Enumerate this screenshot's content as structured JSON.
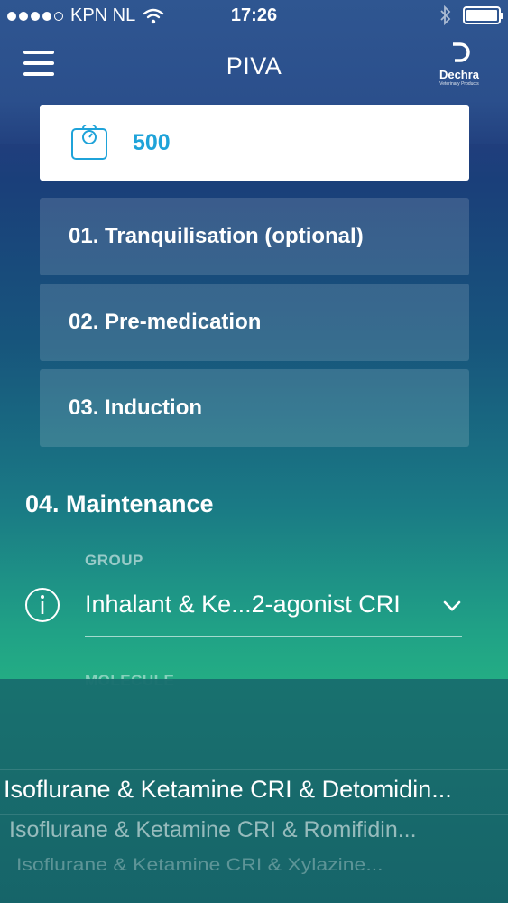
{
  "status_bar": {
    "carrier": "KPN NL",
    "time": "17:26",
    "signal_bars": 4,
    "signal_total": 5
  },
  "nav": {
    "title": "PIVA",
    "menu_icon": "hamburger-menu-icon",
    "logo_name": "Dechra",
    "logo_sub": "Veterinary Products"
  },
  "weight": {
    "icon": "scale-icon",
    "value": "500",
    "color": "#1fa3d9"
  },
  "steps": [
    {
      "label": "01. Tranquilisation (optional)"
    },
    {
      "label": "02. Pre-medication"
    },
    {
      "label": "03. Induction"
    }
  ],
  "maintenance": {
    "title": "04. Maintenance",
    "group_label": "GROUP",
    "group_value": "Inhalant & Ke...2-agonist CRI",
    "molecule_label": "MOLECULE"
  },
  "picker": {
    "items": [
      "Isoflurane & Ketamine CRI & Detomidin...",
      "Isoflurane & Ketamine CRI & Romifidin...",
      "Isoflurane & Ketamine CRI & Xylazine..."
    ]
  }
}
